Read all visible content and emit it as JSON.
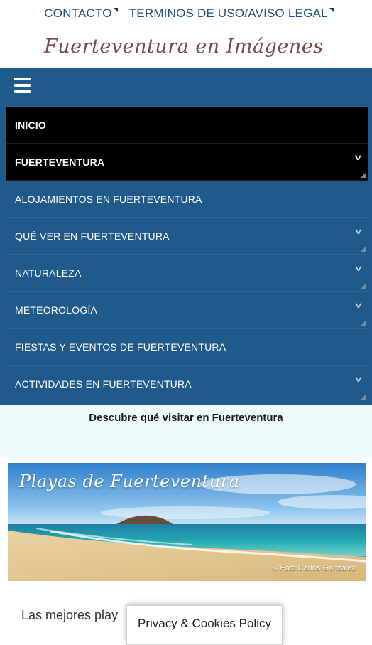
{
  "topnav": {
    "contact": "CONTACTO",
    "terms": "TERMINOS DE USO/AVISO LEGAL"
  },
  "site_title": "Fuerteventura en Imágenes",
  "menu": {
    "toggle_icon": "hamburger-menu-icon",
    "items": [
      {
        "label": "INICIO",
        "has_submenu": false
      },
      {
        "label": "FUERTEVENTURA",
        "has_submenu": true
      },
      {
        "label": "ALOJAMIENTOS EN FUERTEVENTURA",
        "has_submenu": false
      },
      {
        "label": "QUÉ VER EN FUERTEVENTURA",
        "has_submenu": true
      },
      {
        "label": "NATURALEZA",
        "has_submenu": true
      },
      {
        "label": "METEOROLOGÍA",
        "has_submenu": true
      },
      {
        "label": "FIESTAS Y EVENTOS DE FUERTEVENTURA",
        "has_submenu": false
      },
      {
        "label": "ACTIVIDADES EN FUERTEVENTURA",
        "has_submenu": true
      }
    ]
  },
  "section": {
    "heading": "Descubre qué visitar en Fuerteventura"
  },
  "banner": {
    "title": "Playas de Fuerteventura",
    "credit": "© Foto:Carlos González"
  },
  "intro_text": "Las mejores play",
  "cookie_notice": "Privacy & Cookies Policy",
  "colors": {
    "menu_bg": "#1f5a8a",
    "menu_active_bg": "#000000",
    "link": "#1f4f82",
    "brand": "#7a4a4a"
  }
}
